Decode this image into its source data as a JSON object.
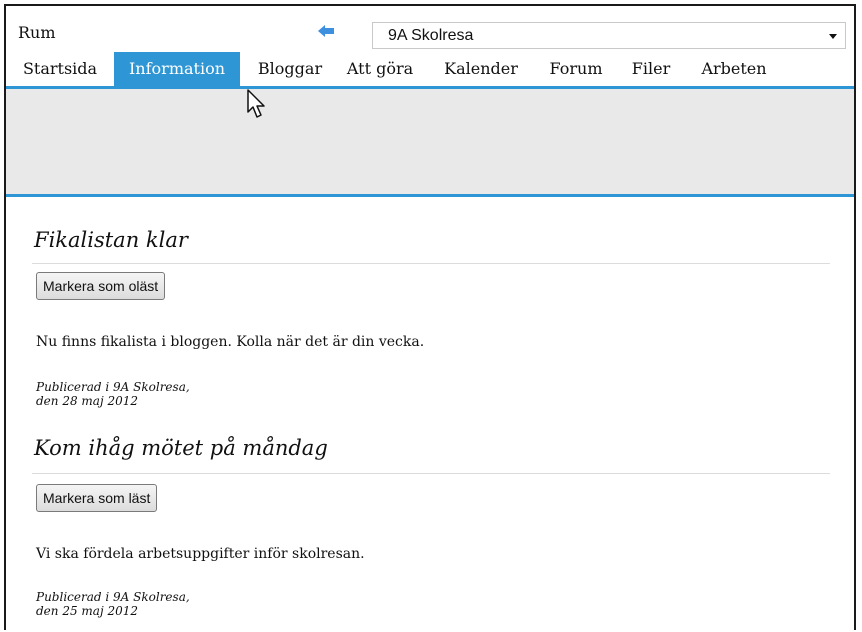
{
  "header": {
    "room_label": "Rum",
    "back_icon": "left-arrow-icon",
    "room_select_value": "9A Skolresa"
  },
  "tabs": [
    {
      "label": "Startsida",
      "active": false
    },
    {
      "label": "Information",
      "active": true
    },
    {
      "label": "Bloggar",
      "active": false
    },
    {
      "label": "Att göra",
      "active": false
    },
    {
      "label": "Kalender",
      "active": false
    },
    {
      "label": "Forum",
      "active": false
    },
    {
      "label": "Filer",
      "active": false
    },
    {
      "label": "Arbeten",
      "active": false
    }
  ],
  "posts": [
    {
      "title": "Fikalistan klar",
      "button_label": "Markera som oläst",
      "body": "Nu finns fikalista i bloggen. Kolla när det är din vecka.",
      "meta_line1": "Publicerad i 9A Skolresa,",
      "meta_line2": "den 28 maj 2012"
    },
    {
      "title": "Kom ihåg mötet på måndag",
      "button_label": "Markera som läst",
      "body": "Vi ska fördela arbetsuppgifter inför skolresan.",
      "meta_line1": "Publicerad i 9A Skolresa,",
      "meta_line2": "den 25 maj 2012"
    }
  ],
  "colors": {
    "accent": "#2e96d4",
    "band": "#e9e9e9"
  }
}
